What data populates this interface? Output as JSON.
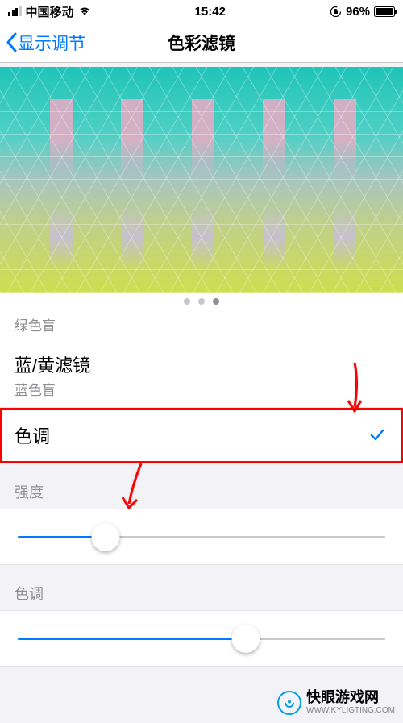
{
  "statusBar": {
    "carrier": "中国移动",
    "time": "15:42",
    "batteryPercent": "96%"
  },
  "nav": {
    "back": "显示调节",
    "title": "色彩滤镜"
  },
  "options": {
    "greenBlind": "绿色盲",
    "blueYellowFilter": {
      "title": "蓝/黄滤镜",
      "sub": "蓝色盲"
    },
    "tint": "色调"
  },
  "sliders": {
    "intensity": {
      "label": "强度",
      "value": 24
    },
    "hue": {
      "label": "色调",
      "value": 62
    }
  },
  "watermark": {
    "cn": "快眼游戏网",
    "url": "WWW.KYLIGTING.COM"
  }
}
